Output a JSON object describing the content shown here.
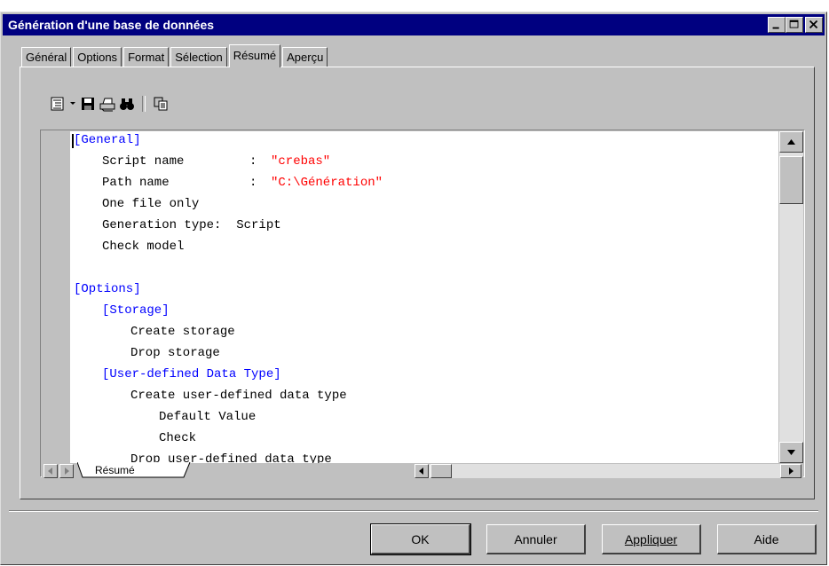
{
  "window": {
    "title": "Génération d'une base de données"
  },
  "tabs": [
    {
      "label": "Général"
    },
    {
      "label": "Options"
    },
    {
      "label": "Format"
    },
    {
      "label": "Sélection"
    },
    {
      "label": "Résumé"
    },
    {
      "label": "Aperçu"
    }
  ],
  "active_tab": "Résumé",
  "toolbar": {
    "icons": [
      "outline-menu-icon",
      "chevron-down-icon",
      "save-icon",
      "print-icon",
      "find-icon",
      "copy-icon"
    ]
  },
  "summary": {
    "lines": [
      {
        "text": "[General]",
        "kind": "section"
      },
      {
        "label": "Script name",
        "sep": ": ",
        "value": "\"crebas\""
      },
      {
        "label": "Path name",
        "sep": ": ",
        "value": "\"C:\\Génération\""
      },
      {
        "text": "One file only"
      },
      {
        "text": "Generation type:  Script"
      },
      {
        "text": "Check model"
      },
      {
        "text": ""
      },
      {
        "text": "[Options]",
        "kind": "section"
      },
      {
        "text": "[Storage]",
        "kind": "section"
      },
      {
        "text": "Create storage"
      },
      {
        "text": "Drop storage"
      },
      {
        "text": "[User-defined Data Type]",
        "kind": "section"
      },
      {
        "text": "Create user-defined data type"
      },
      {
        "text": "Default Value"
      },
      {
        "text": "Check"
      },
      {
        "text": "Drop user-defined data type"
      }
    ],
    "sheet_tab": "Résumé"
  },
  "buttons": {
    "ok": "OK",
    "cancel": "Annuler",
    "apply": "Appliquer",
    "help": "Aide"
  },
  "colors": {
    "section": "#0000ff",
    "string_value": "#ff0000",
    "titlebar": "#000080"
  }
}
